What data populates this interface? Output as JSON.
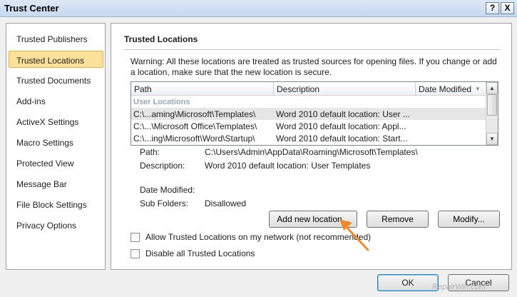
{
  "window": {
    "title": "Trust Center",
    "help_glyph": "?",
    "close_glyph": "X"
  },
  "nav": {
    "items": [
      {
        "label": "Trusted Publishers",
        "selected": false
      },
      {
        "label": "Trusted Locations",
        "selected": true
      },
      {
        "label": "Trusted Documents",
        "selected": false
      },
      {
        "label": "Add-ins",
        "selected": false
      },
      {
        "label": "ActiveX Settings",
        "selected": false
      },
      {
        "label": "Macro Settings",
        "selected": false
      },
      {
        "label": "Protected View",
        "selected": false
      },
      {
        "label": "Message Bar",
        "selected": false
      },
      {
        "label": "File Block Settings",
        "selected": false
      },
      {
        "label": "Privacy Options",
        "selected": false
      }
    ]
  },
  "main": {
    "section_title": "Trusted Locations",
    "warning": "Warning: All these locations are treated as trusted sources for opening files.  If you change or add a location, make sure that the new location is secure.",
    "list": {
      "columns": [
        "Path",
        "Description",
        "Date Modified"
      ],
      "sort_glyph": "▼",
      "group_label": "User Locations",
      "rows": [
        {
          "path": "C:\\...aming\\Microsoft\\Templates\\",
          "description": "Word 2010 default location: User ...",
          "date": "",
          "selected": true
        },
        {
          "path": "C:\\...\\Microsoft Office\\Templates\\",
          "description": "Word 2010 default location: Appl...",
          "date": "",
          "selected": false
        },
        {
          "path": "C:\\...ing\\Microsoft\\Word\\Startup\\",
          "description": "Word 2010 default location: Start...",
          "date": "",
          "selected": false
        }
      ]
    },
    "details": {
      "path_label": "Path:",
      "path_value": "C:\\Users\\Admin\\AppData\\Roaming\\Microsoft\\Templates\\",
      "description_label": "Description:",
      "description_value": "Word 2010 default location: User Templates",
      "date_label": "Date Modified:",
      "date_value": "",
      "subfolders_label": "Sub Folders:",
      "subfolders_value": "Disallowed"
    },
    "buttons": {
      "add": "Add new location...",
      "remove": "Remove",
      "modify": "Modify..."
    },
    "options": {
      "allow_network": {
        "label": "Allow Trusted Locations on my network (not recommended)",
        "checked": false
      },
      "disable_all": {
        "label": "Disable all Trusted Locations",
        "checked": false
      }
    }
  },
  "footer": {
    "ok": "OK",
    "cancel": "Cancel"
  },
  "watermark": "RepairWin.com",
  "colors": {
    "selection_nav": "#fbe19a",
    "arrow": "#f08a2b",
    "group_label": "#9aa7b5"
  }
}
